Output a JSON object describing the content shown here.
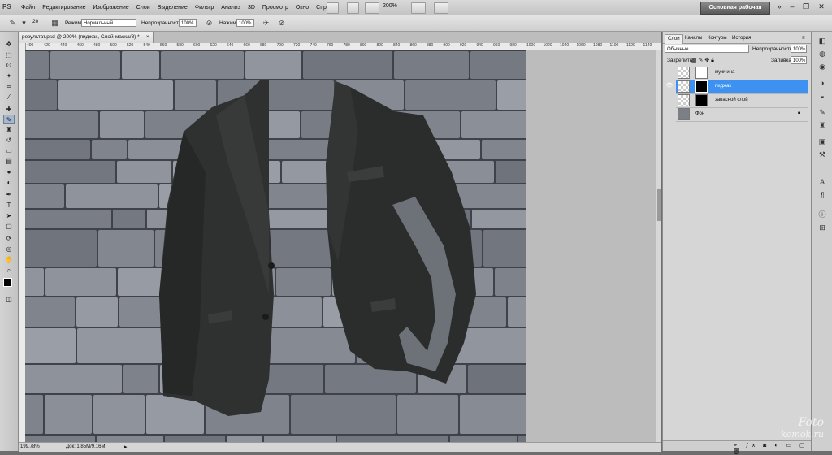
{
  "menu": {
    "logo": "PS",
    "items": [
      "Файл",
      "Редактирование",
      "Изображение",
      "Слои",
      "Выделение",
      "Фильтр",
      "Анализ",
      "3D",
      "Просмотр",
      "Окно",
      "Справка"
    ],
    "zoom": "200%",
    "workspace": "Основная рабочая среда"
  },
  "options": {
    "brush_size": "20",
    "mode_label": "Режим:",
    "mode_value": "Нормальный",
    "opacity_label": "Непрозрачность:",
    "opacity_value": "100%",
    "flow_label": "Нажим:",
    "flow_value": "100%"
  },
  "document": {
    "tab_title": "результат.psd @ 200% (пиджак, Слой-маска/8) *",
    "ruler_ticks": [
      "400",
      "420",
      "440",
      "460",
      "480",
      "500",
      "520",
      "540",
      "560",
      "580",
      "600",
      "620",
      "640",
      "660",
      "680",
      "700",
      "720",
      "740",
      "760",
      "780",
      "800",
      "820",
      "840",
      "860",
      "880",
      "900",
      "920",
      "940",
      "960",
      "980",
      "1000",
      "1020",
      "1040",
      "1060",
      "1080",
      "1100",
      "1120",
      "1140"
    ],
    "zoom_status": "199.78%",
    "doc_status": "Док: 1,85M/9,16M"
  },
  "panel": {
    "tabs": [
      "Слои",
      "Каналы",
      "Контуры",
      "История"
    ],
    "blend_mode": "Обычные",
    "opacity_label": "Непрозрачность:",
    "opacity_value": "100%",
    "lock_label": "Закрепить:",
    "fill_label": "Заливка:",
    "fill_value": "100%",
    "layers": [
      {
        "name": "мужчина",
        "visible": false,
        "selected": false
      },
      {
        "name": "пиджак",
        "visible": true,
        "selected": true
      },
      {
        "name": "запасной слой",
        "visible": false,
        "selected": false
      },
      {
        "name": "Фон",
        "visible": false,
        "selected": false
      }
    ]
  },
  "watermark": {
    "line1": "Foto",
    "line2": "komok.ru"
  }
}
